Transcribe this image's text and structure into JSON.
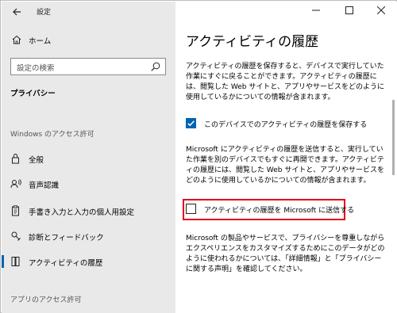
{
  "window": {
    "title": "設定",
    "controls": {
      "minimize": "—",
      "maximize": "☐",
      "close": "✕"
    }
  },
  "sidebar": {
    "home_label": "ホーム",
    "search_placeholder": "設定の検索",
    "section_title": "プライバシー",
    "windows_permissions_header": "Windows のアクセス許可",
    "items": [
      {
        "label": "全般",
        "icon": "lock-icon"
      },
      {
        "label": "音声認識",
        "icon": "speech-icon"
      },
      {
        "label": "手書き入力と入力の個人用設定",
        "icon": "clipboard-icon"
      },
      {
        "label": "診断とフィードバック",
        "icon": "feedback-icon"
      },
      {
        "label": "アクティビティの履歴",
        "icon": "history-icon",
        "active": true
      }
    ],
    "app_permissions_header": "アプリのアクセス許可"
  },
  "main": {
    "title": "アクティビティの履歴",
    "intro_text": "アクティビティの履歴を保存すると、デバイスで実行していた作業にすぐに戻ることができます。アクティビティの履歴には、閲覧した Web サイトと、アプリやサービスをどのように使用しているかについての情報が含まれます。",
    "checkbox_save": {
      "label": "このデバイスでのアクティビティの履歴を保存する",
      "checked": true
    },
    "send_text": "Microsoft にアクティビティの履歴を送信すると、実行していた作業を別のデバイスでもすぐに再開できます。アクティビティの履歴には、閲覧した Web サイトと、アプリやサービスをどのように使用しているかについての情報が含まれます。",
    "checkbox_send": {
      "label": "アクティビティの履歴を Microsoft に送信する",
      "checked": false
    },
    "privacy_text": "Microsoft の製品やサービスで、プライバシーを尊重しながらエクスペリエンスをカスタマイズするためにこのデータがどのように使われるかについては、「詳細情報」と「プライバシーに関する声明」を確認してください。"
  },
  "colors": {
    "accent": "#0063b1",
    "highlight": "#e3001b",
    "sidebar_bg": "#e9e9e9"
  }
}
